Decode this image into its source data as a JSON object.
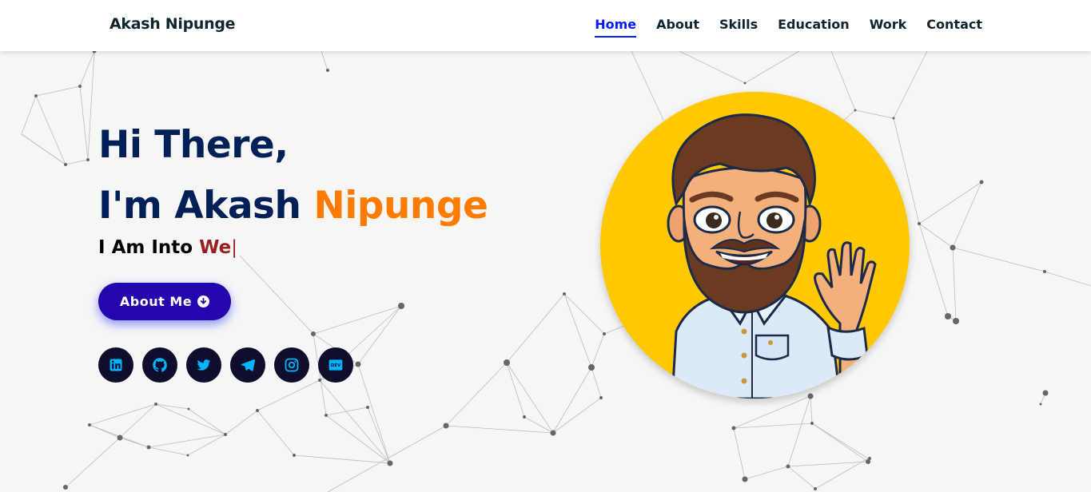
{
  "header": {
    "brand": "Akash Nipunge",
    "nav": [
      {
        "label": "Home",
        "active": true
      },
      {
        "label": "About",
        "active": false
      },
      {
        "label": "Skills",
        "active": false
      },
      {
        "label": "Education",
        "active": false
      },
      {
        "label": "Work",
        "active": false
      },
      {
        "label": "Contact",
        "active": false
      }
    ]
  },
  "hero": {
    "greeting": "Hi There,",
    "intro_prefix": "I'm Akash ",
    "intro_name": "Nipunge",
    "typing_prefix": "I Am Into ",
    "typing_text": "We",
    "caret": "|",
    "about_button": "About Me",
    "about_button_icon": "arrow-circle-down-icon",
    "socials": [
      {
        "name": "linkedin-icon"
      },
      {
        "name": "github-icon"
      },
      {
        "name": "twitter-icon"
      },
      {
        "name": "telegram-icon"
      },
      {
        "name": "instagram-icon"
      },
      {
        "name": "dev-icon",
        "text": "DEV"
      }
    ],
    "avatar": "avatar-illustration"
  },
  "colors": {
    "heading": "#002057",
    "accent": "#ff7b00",
    "typed": "#991e1e",
    "button": "#2506ad",
    "nav_active": "#011aff",
    "avatar_bg": "#ffc800",
    "social_bg": "#0e0e2c",
    "social_icon": "#00b4ff"
  }
}
